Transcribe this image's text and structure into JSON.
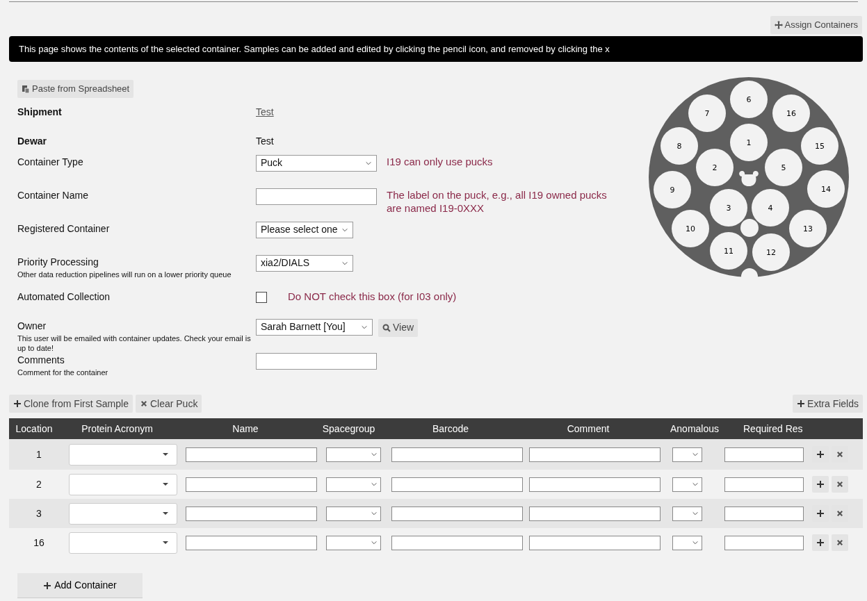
{
  "toolbar": {
    "assign_button": "Assign Containers"
  },
  "info_banner": "This page shows the contents of the selected container. Samples can be added and edited by clicking the pencil icon, and removed by clicking the x",
  "paste_button": "Paste from Spreadsheet",
  "form": [
    {
      "kind": "link",
      "label": "Shipment",
      "value": "Test"
    },
    {
      "kind": "text",
      "label": "Dewar",
      "value": "Test"
    },
    {
      "kind": "select",
      "label": "Container Type",
      "value": "Puck",
      "note": "I19 can only use pucks"
    },
    {
      "kind": "input",
      "label": "Container Name",
      "note": "The label on the puck, e.g., all I19 owned pucks are named I19-0XXX"
    },
    {
      "kind": "select",
      "label": "Registered Container",
      "value": "Please select one"
    },
    {
      "kind": "select",
      "label": "Priority Processing",
      "hint": "Other data reduction pipelines will run on a lower priority queue",
      "value": "xia2/DIALS"
    },
    {
      "kind": "checkbox",
      "label": "Automated Collection",
      "checked": false,
      "note": "Do NOT check this box (for I03 only)"
    },
    {
      "kind": "select",
      "label": "Owner",
      "hint": "This user will be emailed with container updates. Check your email is up to date!",
      "value": "Sarah Barnett [You]",
      "button": "View"
    },
    {
      "kind": "input",
      "label": "Comments",
      "hint": "Comment for the container"
    }
  ],
  "puck_positions": [
    "6",
    "7",
    "16",
    "1",
    "8",
    "15",
    "2",
    "5",
    "9",
    "14",
    "3",
    "4",
    "10",
    "13",
    "11",
    "12"
  ],
  "actions": {
    "clone_button": "Clone from First Sample",
    "clear_button": "Clear Puck",
    "extra_button": "Extra Fields"
  },
  "table": {
    "columns": [
      "Location",
      "Protein Acronym",
      "Name",
      "Spacegroup",
      "Barcode",
      "Comment",
      "Anomalous",
      "Required Res"
    ],
    "rows": [
      {
        "location": "1"
      },
      {
        "location": "2"
      },
      {
        "location": "3"
      },
      {
        "location": "16"
      }
    ]
  },
  "add_button": "Add Container"
}
